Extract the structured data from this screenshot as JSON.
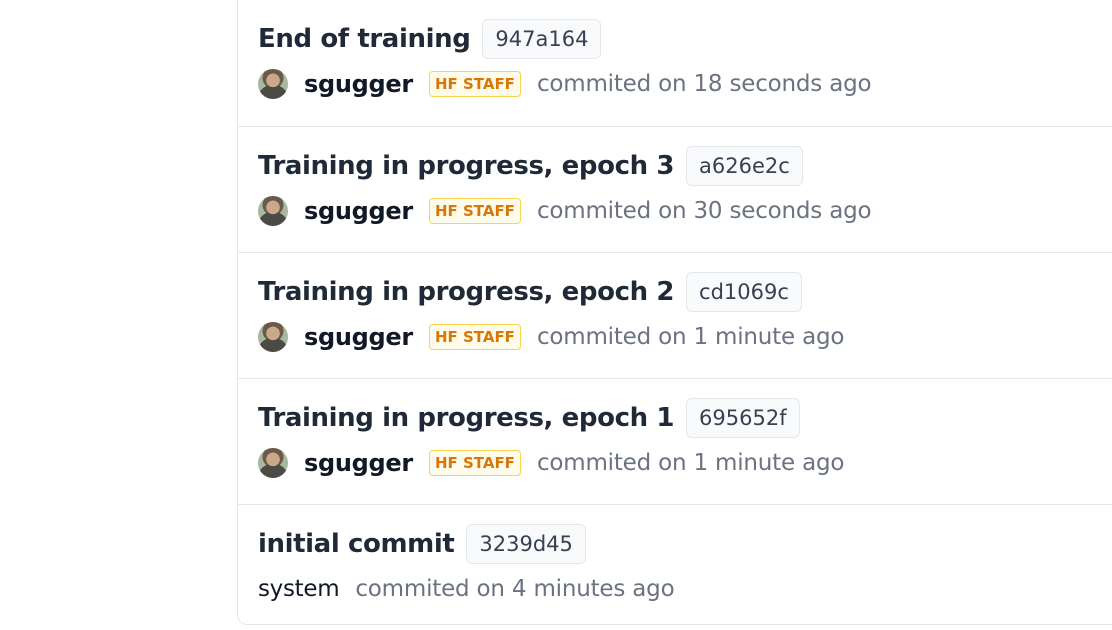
{
  "commits": [
    {
      "title": "End of training",
      "sha": "947a164",
      "author": "sgugger",
      "badge": "HF STAFF",
      "time": "commited on 18 seconds ago"
    },
    {
      "title": "Training in progress, epoch 3",
      "sha": "a626e2c",
      "author": "sgugger",
      "badge": "HF STAFF",
      "time": "commited on 30 seconds ago"
    },
    {
      "title": "Training in progress, epoch 2",
      "sha": "cd1069c",
      "author": "sgugger",
      "badge": "HF STAFF",
      "time": "commited on 1 minute ago"
    },
    {
      "title": "Training in progress, epoch 1",
      "sha": "695652f",
      "author": "sgugger",
      "badge": "HF STAFF",
      "time": "commited on 1 minute ago"
    },
    {
      "title": "initial commit",
      "sha": "3239d45",
      "author": "system",
      "time": "commited on 4 minutes ago"
    }
  ],
  "colors": {
    "staff_badge_text": "#d97706",
    "staff_badge_border": "#fcd34d",
    "muted_text": "#6b7280",
    "divider": "#e5e7eb"
  }
}
